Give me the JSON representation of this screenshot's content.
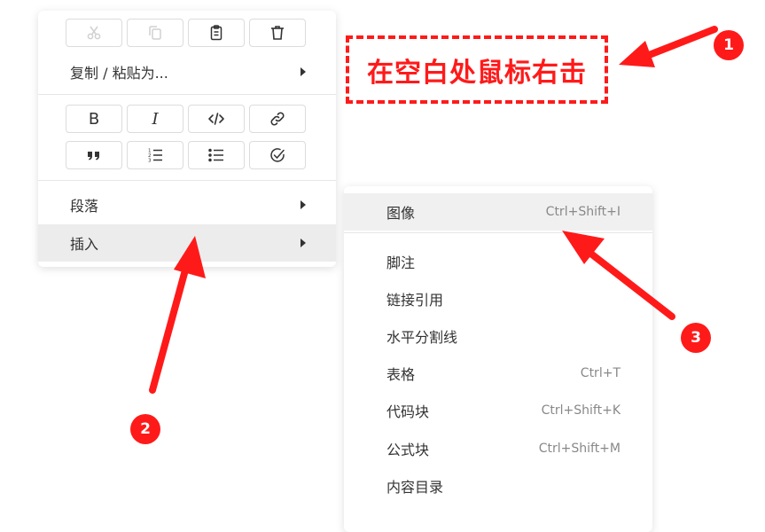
{
  "context_menu": {
    "edit_icons": [
      {
        "name": "cut-icon",
        "state": "disabled"
      },
      {
        "name": "copy-icon",
        "state": "disabled"
      },
      {
        "name": "paste-icon",
        "state": "enabled"
      },
      {
        "name": "delete-icon",
        "state": "enabled"
      }
    ],
    "copy_paste_as_label": "复制 / 粘贴为...",
    "format_row1": [
      {
        "name": "bold-icon",
        "glyph": "B"
      },
      {
        "name": "italic-icon",
        "glyph": "I"
      },
      {
        "name": "code-icon"
      },
      {
        "name": "link-icon"
      }
    ],
    "format_row2": [
      {
        "name": "quote-icon"
      },
      {
        "name": "ordered-list-icon"
      },
      {
        "name": "unordered-list-icon"
      },
      {
        "name": "task-list-icon"
      }
    ],
    "paragraph_label": "段落",
    "insert_label": "插入"
  },
  "insert_submenu": {
    "items": [
      {
        "label": "图像",
        "shortcut": "Ctrl+Shift+I"
      },
      {
        "label": "脚注",
        "shortcut": ""
      },
      {
        "label": "链接引用",
        "shortcut": ""
      },
      {
        "label": "水平分割线",
        "shortcut": ""
      },
      {
        "label": "表格",
        "shortcut": "Ctrl+T"
      },
      {
        "label": "代码块",
        "shortcut": "Ctrl+Shift+K"
      },
      {
        "label": "公式块",
        "shortcut": "Ctrl+Shift+M"
      },
      {
        "label": "内容目录",
        "shortcut": ""
      }
    ]
  },
  "annotations": {
    "callout_text": "在空白处鼠标右击",
    "badge_1": "1",
    "badge_2": "2",
    "badge_3": "3",
    "accent_color": "#ff1a1a"
  }
}
